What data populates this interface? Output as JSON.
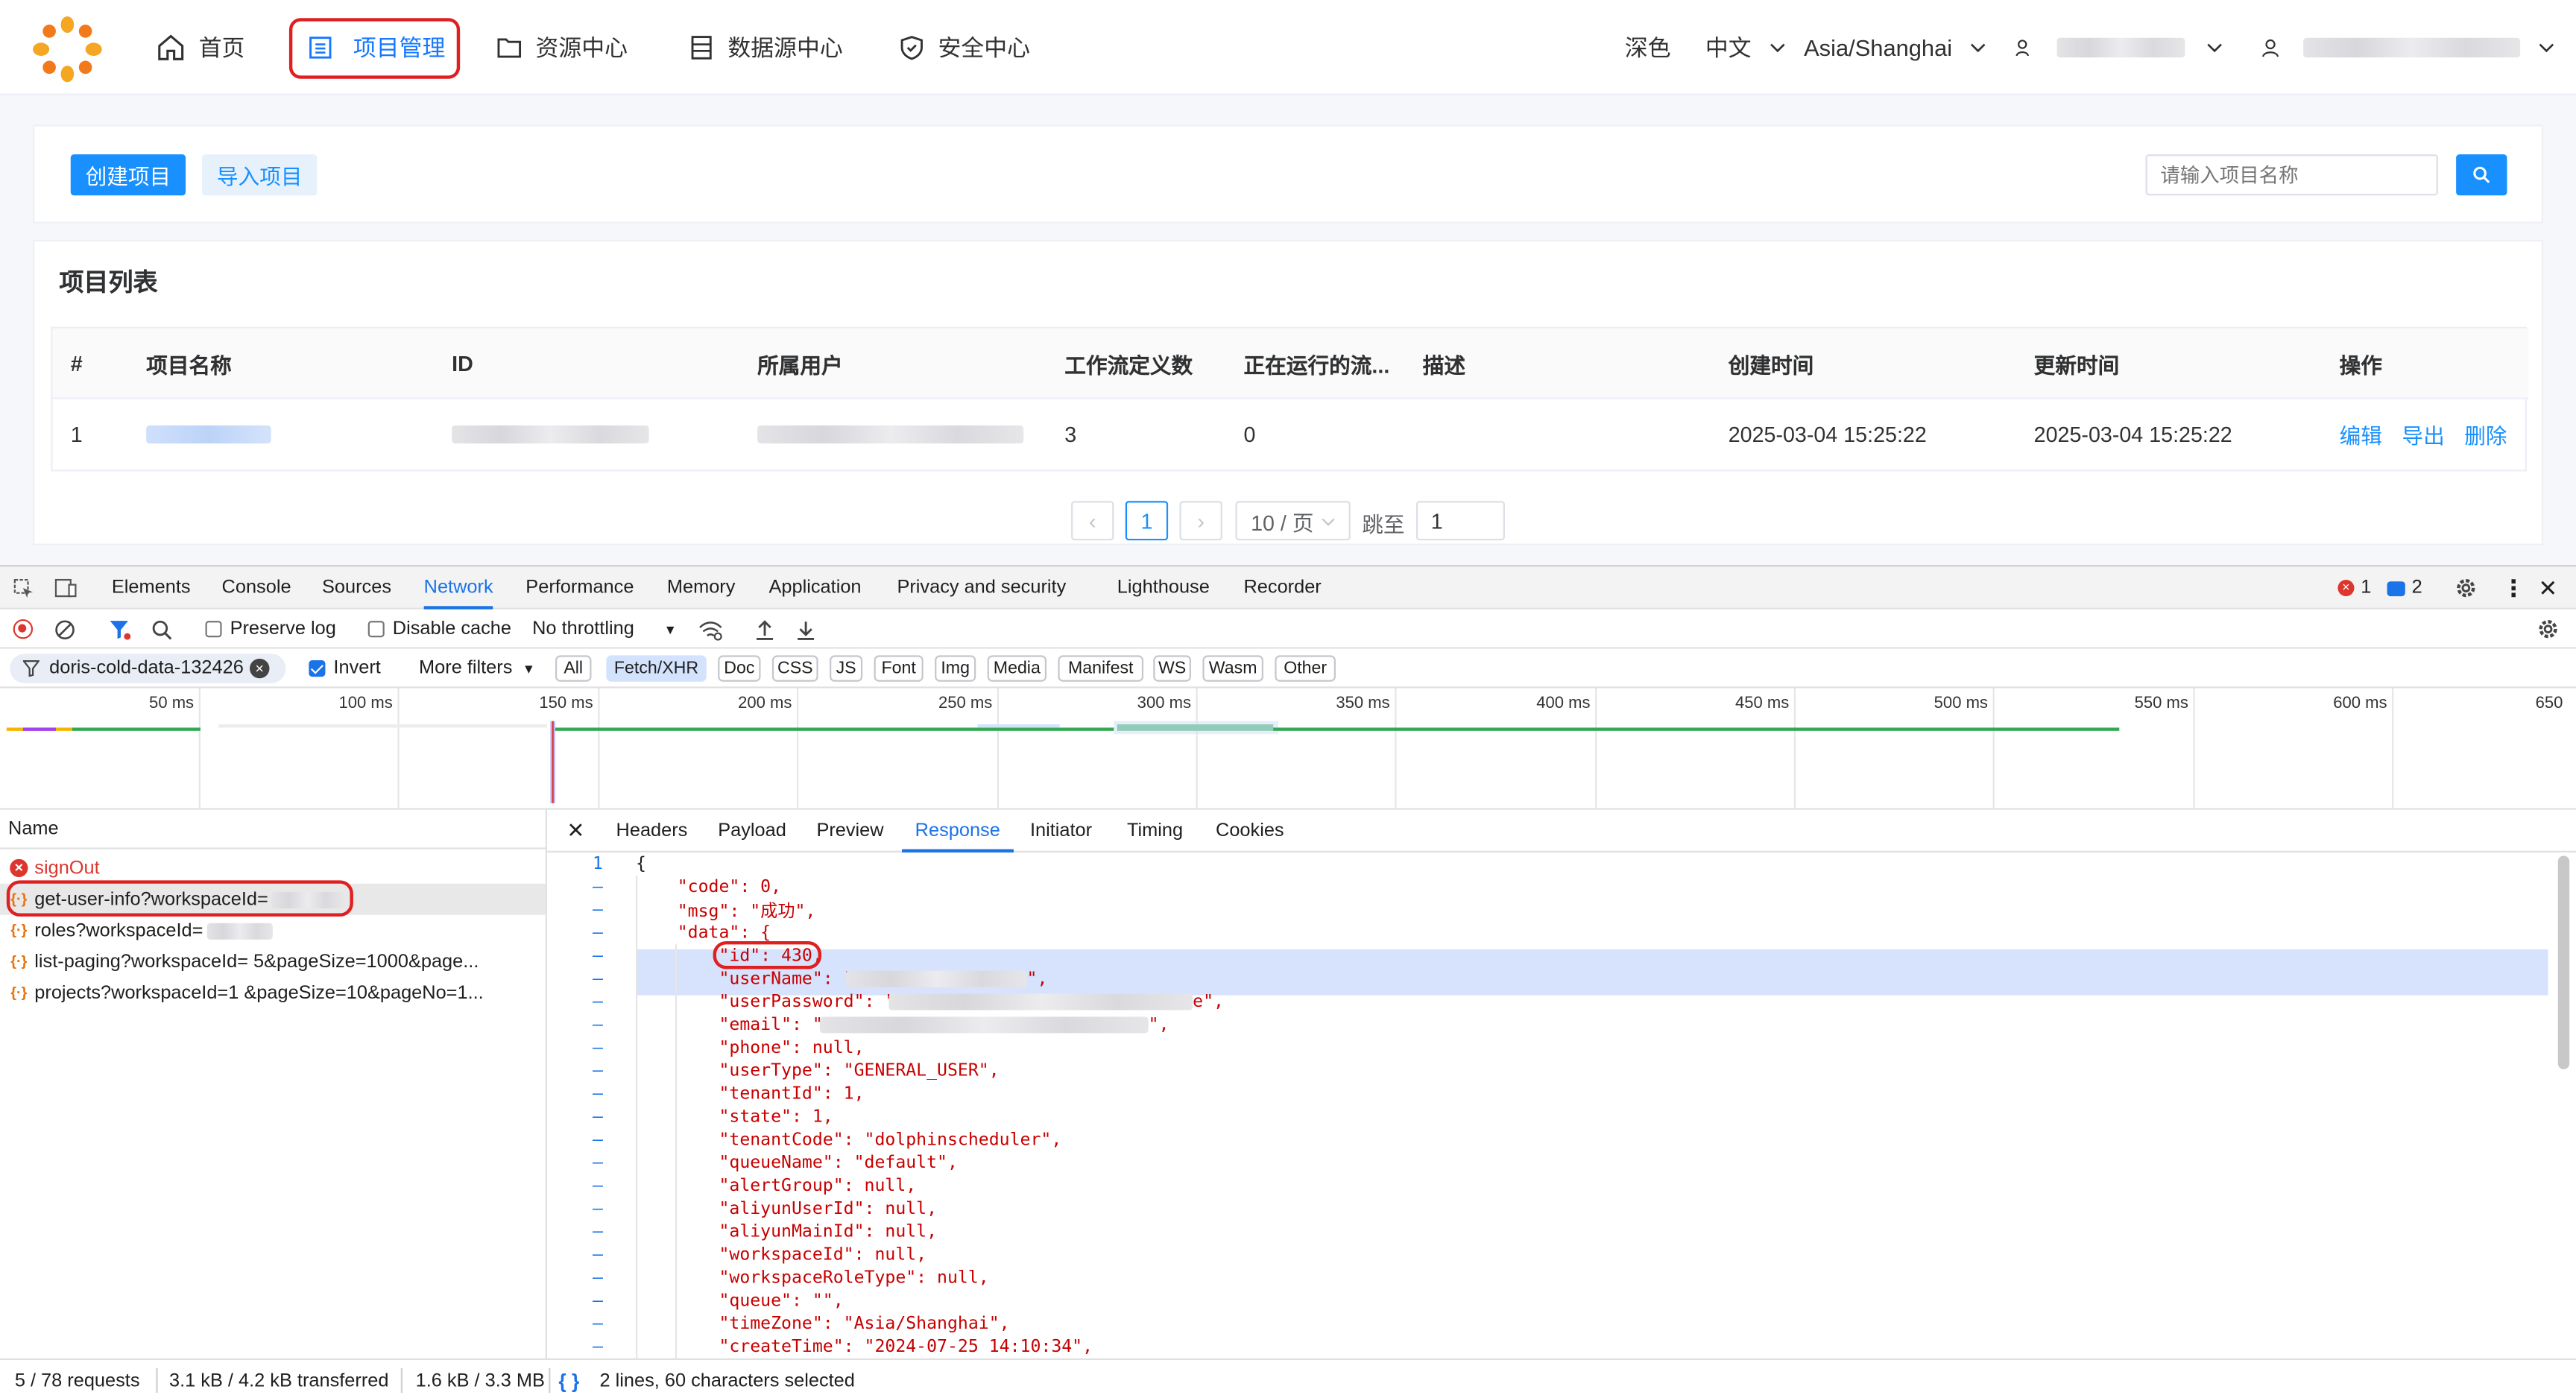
{
  "header": {
    "nav": [
      {
        "label": "首页",
        "icon": "home-icon"
      },
      {
        "label": "项目管理",
        "icon": "project-icon"
      },
      {
        "label": "资源中心",
        "icon": "folder-icon"
      },
      {
        "label": "数据源中心",
        "icon": "datasource-icon"
      },
      {
        "label": "安全中心",
        "icon": "shield-icon"
      }
    ],
    "theme": "深色",
    "language": "中文",
    "timezone": "Asia/Shanghai"
  },
  "toolbar": {
    "create_label": "创建项目",
    "import_label": "导入项目",
    "search_placeholder": "请输入项目名称"
  },
  "table": {
    "title": "项目列表",
    "columns": [
      "#",
      "项目名称",
      "ID",
      "所属用户",
      "工作流定义数",
      "正在运行的流...",
      "描述",
      "创建时间",
      "更新时间",
      "操作"
    ],
    "rows": [
      {
        "index": "1",
        "workflow_count": "3",
        "running": "0",
        "description": "",
        "created": "2025-03-04 15:25:22",
        "updated": "2025-03-04 15:25:22",
        "actions": [
          "编辑",
          "导出",
          "删除"
        ]
      }
    ]
  },
  "pagination": {
    "current": "1",
    "page_size": "10 / 页",
    "jump_label": "跳至",
    "jump_value": "1"
  },
  "devtools": {
    "tabs": [
      "Elements",
      "Console",
      "Sources",
      "Network",
      "Performance",
      "Memory",
      "Application",
      "Privacy and security",
      "Lighthouse",
      "Recorder"
    ],
    "error_count": "1",
    "issue_count": "2",
    "toolbar": {
      "preserve_log": "Preserve log",
      "disable_cache": "Disable cache",
      "throttling": "No throttling"
    },
    "filter": {
      "value": "doris-cold-data-132426",
      "invert": "Invert",
      "more_filters": "More filters"
    },
    "filter_types": [
      "All",
      "Fetch/XHR",
      "Doc",
      "CSS",
      "JS",
      "Font",
      "Img",
      "Media",
      "Manifest",
      "WS",
      "Wasm",
      "Other"
    ],
    "timeline_ticks": [
      "50 ms",
      "100 ms",
      "150 ms",
      "200 ms",
      "250 ms",
      "300 ms",
      "350 ms",
      "400 ms",
      "450 ms",
      "500 ms",
      "550 ms",
      "600 ms",
      "650"
    ],
    "name_header": "Name",
    "requests": [
      {
        "name": "signOut",
        "status": "error"
      },
      {
        "name": "get-user-info?workspaceId=",
        "status": "ok"
      },
      {
        "name": "roles?workspaceId=",
        "status": "ok"
      },
      {
        "name": "list-paging?workspaceId=      5&pageSize=1000&page...",
        "status": "ok"
      },
      {
        "name": "projects?workspaceId=1        &pageSize=10&pageNo=1...",
        "status": "ok"
      }
    ],
    "detail_tabs": [
      "Headers",
      "Payload",
      "Preview",
      "Response",
      "Initiator",
      "Timing",
      "Cookies"
    ],
    "response_lines": [
      {
        "num": "1",
        "text": "{"
      },
      {
        "num": "–",
        "text": "    \"code\": 0,"
      },
      {
        "num": "–",
        "text": "    \"msg\": \"成功\","
      },
      {
        "num": "–",
        "text": "    \"data\": {"
      },
      {
        "num": "–",
        "text": "        \"id\": 430,"
      },
      {
        "num": "–",
        "text": "        \"userName\": \""
      },
      {
        "num": "–",
        "text": "        \"userPassword\": \""
      },
      {
        "num": "–",
        "text": "        \"email\": \""
      },
      {
        "num": "–",
        "text": "        \"phone\": null,"
      },
      {
        "num": "–",
        "text": "        \"userType\": \"GENERAL_USER\","
      },
      {
        "num": "–",
        "text": "        \"tenantId\": 1,"
      },
      {
        "num": "–",
        "text": "        \"state\": 1,"
      },
      {
        "num": "–",
        "text": "        \"tenantCode\": \"dolphinscheduler\","
      },
      {
        "num": "–",
        "text": "        \"queueName\": \"default\","
      },
      {
        "num": "–",
        "text": "        \"alertGroup\": null,"
      },
      {
        "num": "–",
        "text": "        \"aliyunUserId\": null,"
      },
      {
        "num": "–",
        "text": "        \"aliyunMainId\": null,"
      },
      {
        "num": "–",
        "text": "        \"workspaceId\": null,"
      },
      {
        "num": "–",
        "text": "        \"workspaceRoleType\": null,"
      },
      {
        "num": "–",
        "text": "        \"queue\": \"\","
      },
      {
        "num": "–",
        "text": "        \"timeZone\": \"Asia/Shanghai\","
      },
      {
        "num": "–",
        "text": "        \"createTime\": \"2024-07-25 14:10:34\","
      }
    ],
    "status": {
      "requests": "5 / 78 requests",
      "transferred": "3.1 kB / 4.2 kB transferred",
      "resources": "1.6 kB / 3.3 MB",
      "selection": "2 lines, 60 characters selected"
    }
  }
}
